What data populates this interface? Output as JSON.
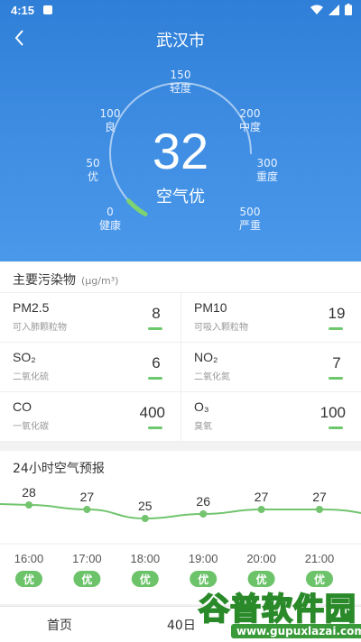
{
  "status": {
    "time": "4:15"
  },
  "header": {
    "city": "武汉市"
  },
  "aqi": {
    "value": "32",
    "label": "空气优",
    "progress_fraction": 0.064,
    "accent_color": "#7ed36f",
    "scale": [
      {
        "value": "0",
        "label": "健康"
      },
      {
        "value": "50",
        "label": "优"
      },
      {
        "value": "100",
        "label": "良"
      },
      {
        "value": "150",
        "label": "轻度"
      },
      {
        "value": "200",
        "label": "中度"
      },
      {
        "value": "300",
        "label": "重度"
      },
      {
        "value": "500",
        "label": "严重"
      }
    ]
  },
  "pollutants": {
    "title": "主要污染物",
    "unit": "(μg/m³)",
    "bar_color": "#6dc86d",
    "items": [
      {
        "name": "PM2.5",
        "cn": "可入肺颗粒物",
        "value": "8"
      },
      {
        "name": "PM10",
        "cn": "可吸入颗粒物",
        "value": "19"
      },
      {
        "name": "SO₂",
        "cn": "二氧化硫",
        "value": "6"
      },
      {
        "name": "NO₂",
        "cn": "二氧化氮",
        "value": "7"
      },
      {
        "name": "CO",
        "cn": "一氧化碳",
        "value": "400"
      },
      {
        "name": "O₃",
        "cn": "臭氧",
        "value": "100"
      }
    ]
  },
  "forecast": {
    "title": "24小时空气预报",
    "line_color": "#72c46e",
    "badge_color": "#6cc36a"
  },
  "chart_data": {
    "type": "line",
    "title": "24小时空气预报",
    "categories": [
      "16:00",
      "17:00",
      "18:00",
      "19:00",
      "20:00",
      "21:00"
    ],
    "series": [
      {
        "values": [
          28,
          27,
          25,
          26,
          27,
          27
        ]
      }
    ],
    "quality_labels": [
      "优",
      "优",
      "优",
      "优",
      "优",
      "优"
    ],
    "ylim": [
      22,
      30
    ],
    "grid": false
  },
  "bottom_nav": {
    "tabs": [
      "首页",
      "40日"
    ]
  },
  "watermark": {
    "cn": "谷普软件园",
    "en": "www.gupuxlazai.com"
  }
}
